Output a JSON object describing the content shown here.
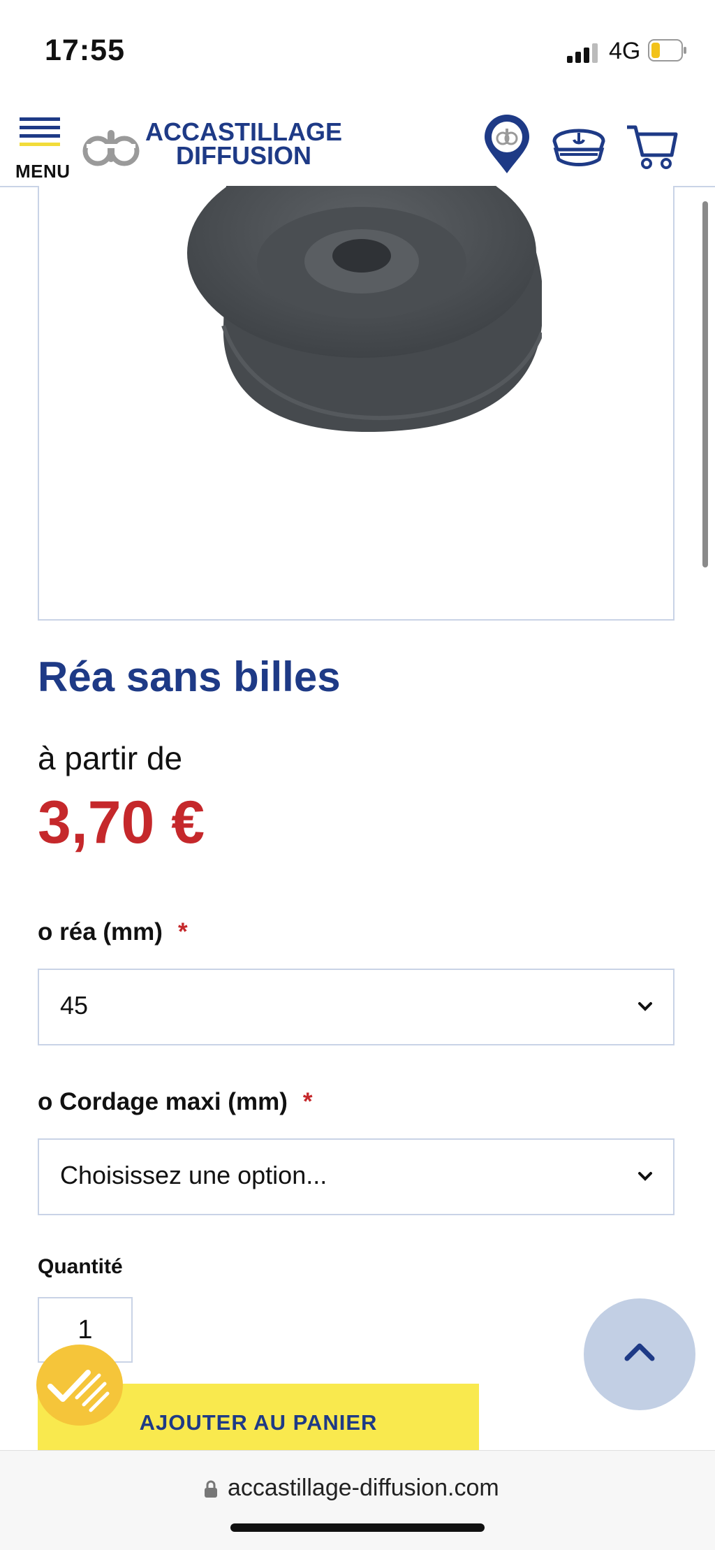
{
  "status_bar": {
    "time": "17:55",
    "network": "4G"
  },
  "header": {
    "menu_label": "MENU",
    "logo_line1": "ACCASTILLAGE",
    "logo_line2": "DIFFUSION",
    "icons": [
      "store-locator-icon",
      "captain-hat-icon",
      "cart-icon"
    ]
  },
  "product": {
    "image_description_icon": "pulley-sheave-image",
    "title": "Réa sans billes",
    "price_prefix": "à partir de",
    "price": "3,70 €"
  },
  "options": [
    {
      "label": "o réa (mm)",
      "required_mark": "*",
      "selected": "45"
    },
    {
      "label": "o Cordage maxi (mm)",
      "required_mark": "*",
      "selected": "Choisissez une option..."
    }
  ],
  "quantity": {
    "label": "Quantité",
    "value": "1"
  },
  "add_to_cart_label": "AJOUTER AU PANIER",
  "browser": {
    "url": "accastillage-diffusion.com"
  },
  "colors": {
    "brand_blue": "#1e3a86",
    "price_red": "#c5282b",
    "cta_yellow": "#f9e94e",
    "border": "#c9d3e6"
  }
}
